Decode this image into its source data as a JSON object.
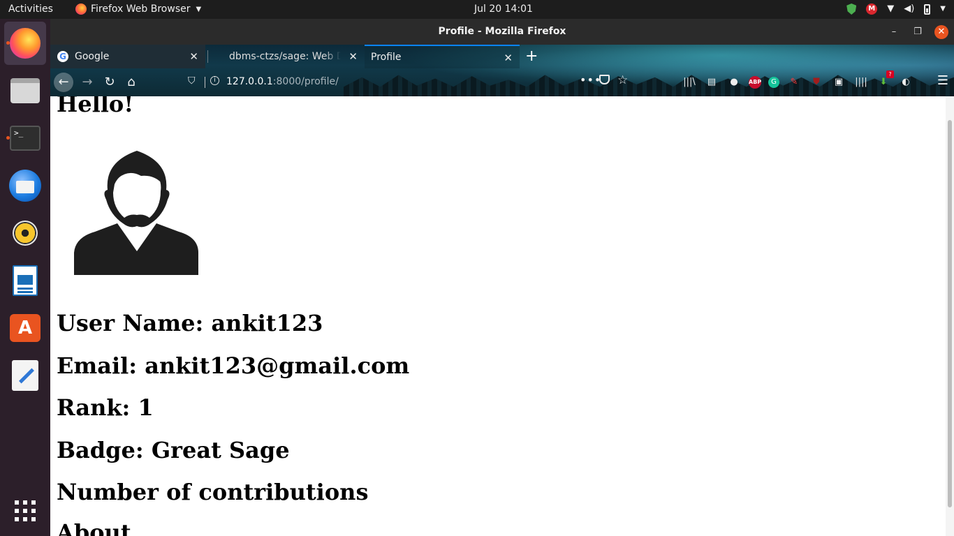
{
  "topbar": {
    "activities": "Activities",
    "app_menu": "Firefox Web Browser",
    "clock": "Jul 20  14:01",
    "tray_icons": [
      "shield-icon",
      "mega-icon",
      "wifi-icon",
      "volume-icon",
      "battery-icon",
      "power-menu-icon"
    ]
  },
  "dock": {
    "apps": [
      "Firefox",
      "Files",
      "Terminal",
      "Thunderbird",
      "Rhythmbox",
      "LibreOffice Writer",
      "Ubuntu Software",
      "Text Editor",
      "Show Applications"
    ]
  },
  "window": {
    "title": "Profile - Mozilla Firefox"
  },
  "tabs": [
    {
      "label": "Google",
      "active": false
    },
    {
      "label": "dbms-ctzs/sage: Web De",
      "active": false
    },
    {
      "label": "Profile",
      "active": true
    }
  ],
  "navbar": {
    "url_host": "127.0.0.1",
    "url_path": ":8000/profile/",
    "more_label": "•••"
  },
  "page": {
    "greeting": "Hello!",
    "username_line": "User Name: ankit123",
    "email_line": "Email: ankit123@gmail.com",
    "rank_line": "Rank: 1",
    "badge_line": "Badge: Great Sage",
    "contributions_line": "Number of contributions",
    "about_line": "About"
  },
  "colors": {
    "accent": "#e95420",
    "tab_highlight": "#0a84ff",
    "dock_bg": "#2c1f2a",
    "topbar_bg": "#1d1d1d"
  }
}
